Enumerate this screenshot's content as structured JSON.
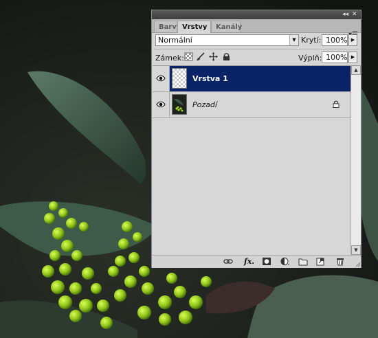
{
  "panel": {
    "tabs": [
      {
        "label": "Barvy",
        "active": false
      },
      {
        "label": "Vrstvy",
        "active": true
      },
      {
        "label": "Kanály",
        "active": false
      }
    ],
    "blend_mode": "Normální",
    "opacity_label": "Krytí:",
    "opacity_value": "100%",
    "lock_label": "Zámek:",
    "fill_label": "Výplň:",
    "fill_value": "100%"
  },
  "layers": [
    {
      "name": "Vrstva 1",
      "selected": true,
      "visible": true,
      "locked": false,
      "thumb": "transparent"
    },
    {
      "name": "Pozadí",
      "selected": false,
      "visible": true,
      "locked": true,
      "thumb": "photo"
    }
  ],
  "icons": {
    "titlebar": [
      "collapse-icon",
      "close-icon"
    ],
    "panel_menu": "panel-menu-icon",
    "lock": [
      "lock-transparent-icon",
      "lock-brush-icon",
      "lock-move-icon",
      "lock-all-icon"
    ],
    "bottom_bar": [
      "link-layers-icon",
      "fx-icon",
      "add-mask-icon",
      "adjustment-icon",
      "new-group-icon",
      "new-layer-icon",
      "delete-layer-icon"
    ]
  },
  "colors": {
    "selected_row": "#0a2467",
    "panel_bg": "#d6d6d6",
    "titlebar": "#3e3e3e"
  }
}
